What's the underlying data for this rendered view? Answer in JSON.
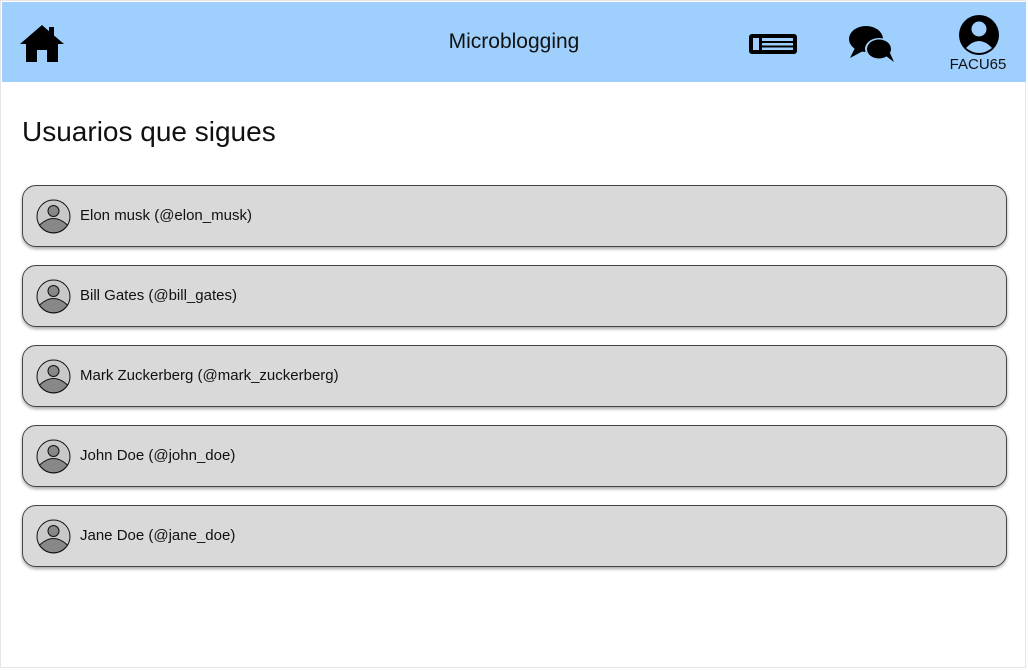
{
  "header": {
    "title": "Microblogging",
    "home_icon": "home-icon",
    "feed_icon": "newspaper-icon",
    "messages_icon": "chat-bubbles-icon",
    "account_icon": "user-circle-icon",
    "username": "FACU65",
    "background_color": "#9fd0fd"
  },
  "main": {
    "title": "Usuarios que sigues",
    "users": [
      {
        "label": "Elon musk (@elon_musk)"
      },
      {
        "label": "Bill Gates (@bill_gates)"
      },
      {
        "label": "Mark Zuckerberg (@mark_zuckerberg)"
      },
      {
        "label": "John Doe (@john_doe)"
      },
      {
        "label": "Jane Doe (@jane_doe)"
      }
    ],
    "card_color": "#d9d9d9"
  }
}
